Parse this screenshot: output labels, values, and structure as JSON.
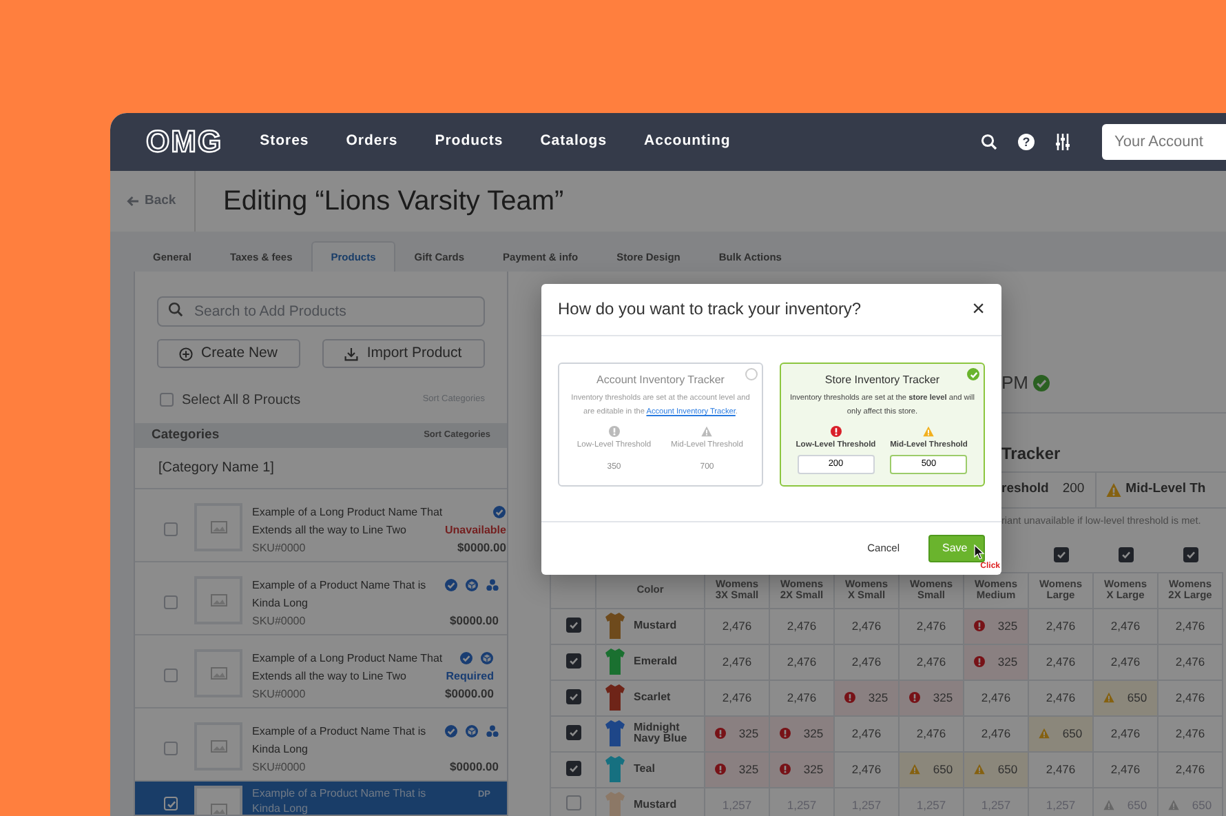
{
  "nav": {
    "logo": "OMG",
    "items": [
      "Stores",
      "Orders",
      "Products",
      "Catalogs",
      "Accounting"
    ],
    "help_glyph": "?",
    "account_placeholder": "Your Account"
  },
  "page": {
    "back": "Back",
    "title": "Editing “Lions Varsity Team”"
  },
  "tabs": [
    {
      "label": "General",
      "selected": false
    },
    {
      "label": "Taxes & fees",
      "selected": false
    },
    {
      "label": "Products",
      "selected": true
    },
    {
      "label": "Gift Cards",
      "selected": false
    },
    {
      "label": "Payment & info",
      "selected": false
    },
    {
      "label": "Store Design",
      "selected": false
    },
    {
      "label": "Bulk Actions",
      "selected": false
    }
  ],
  "products_panel": {
    "search_placeholder": "Search to Add Products",
    "create_button": "Create New",
    "import_button": "Import Product",
    "select_all": {
      "label": "Select All 8 Proucts",
      "checked": false
    },
    "sort_link": "Sort Categories",
    "categories_header": "Categories",
    "categories_sort": "Sort Categories",
    "category": "[Category Name 1]",
    "products": [
      {
        "name": "Example of a Long Product Name That Extends all the way to Line Two",
        "sku": "SKU#0000",
        "price": "$0000.00",
        "badges": [
          {
            "kind": "check"
          }
        ],
        "status": {
          "kind": "unavailable",
          "text": "Unavailable"
        },
        "checked": false,
        "selected": false
      },
      {
        "name": "Example of a Product Name That is Kinda Long",
        "sku": "SKU#0000",
        "price": "$0000.00",
        "badges": [
          {
            "kind": "check"
          },
          {
            "kind": "cube"
          },
          {
            "kind": "dots"
          }
        ],
        "checked": false,
        "selected": false
      },
      {
        "name": "Example of a Long Product Name That Extends all the way to Line Two",
        "sku": "SKU#0000",
        "price": "$0000.00",
        "badges": [
          {
            "kind": "check"
          },
          {
            "kind": "cube"
          }
        ],
        "status": {
          "kind": "required",
          "text": "Required"
        },
        "checked": false,
        "selected": false
      },
      {
        "name": "Example of a Product Name That is Kinda Long",
        "sku": "SKU#0000",
        "price": "$0000.00",
        "badges": [
          {
            "kind": "check"
          },
          {
            "kind": "cube"
          },
          {
            "kind": "dots"
          }
        ],
        "checked": false,
        "selected": false
      },
      {
        "name": "Example of a Product Name That is Kinda Long",
        "code": "DP",
        "checked": true,
        "selected": true
      }
    ]
  },
  "inventory": {
    "saved_time": "PM",
    "heading": "Tracker",
    "thresholds": [
      {
        "label": "reshold",
        "value": "200"
      },
      {
        "kind": "mid",
        "label": "Mid-Level Th"
      }
    ],
    "note": "riant unavailable if low-level threshold is met.",
    "table": {
      "color_header": "Color",
      "columns": [
        {
          "label": "Womens\n3X Small"
        },
        {
          "label": "Womens\n2X Small"
        },
        {
          "label": "Womens\nX Small"
        },
        {
          "label": "Womens\nSmall"
        },
        {
          "label": "Womens\nMedium"
        },
        {
          "label": "Womens\nLarge",
          "checked": true
        },
        {
          "label": "Womens\nX Large",
          "checked": true
        },
        {
          "label": "Womens\n2X Large",
          "checked": true
        }
      ],
      "rows": [
        {
          "name": "Mustard",
          "color": "#6e4a1c",
          "checked": true,
          "cells": [
            {
              "kind": "ok",
              "value": "2,476"
            },
            {
              "kind": "ok",
              "value": "2,476"
            },
            {
              "kind": "ok",
              "value": "2,476"
            },
            {
              "kind": "ok",
              "value": "2,476"
            },
            {
              "kind": "low",
              "value": "325"
            },
            {
              "kind": "ok",
              "value": "2,476"
            },
            {
              "kind": "ok",
              "value": "2,476"
            },
            {
              "kind": "ok",
              "value": "2,476"
            }
          ]
        },
        {
          "name": "Emerald",
          "color": "#1a7030",
          "checked": true,
          "cells": [
            {
              "kind": "ok",
              "value": "2,476"
            },
            {
              "kind": "ok",
              "value": "2,476"
            },
            {
              "kind": "ok",
              "value": "2,476"
            },
            {
              "kind": "ok",
              "value": "2,476"
            },
            {
              "kind": "low",
              "value": "325"
            },
            {
              "kind": "ok",
              "value": "2,476"
            },
            {
              "kind": "ok",
              "value": "2,476"
            },
            {
              "kind": "ok",
              "value": "2,476"
            }
          ]
        },
        {
          "name": "Scarlet",
          "color": "#6e2418",
          "checked": true,
          "cells": [
            {
              "kind": "ok",
              "value": "2,476"
            },
            {
              "kind": "ok",
              "value": "2,476"
            },
            {
              "kind": "low",
              "value": "325"
            },
            {
              "kind": "low",
              "value": "325"
            },
            {
              "kind": "ok",
              "value": "2,476"
            },
            {
              "kind": "ok",
              "value": "2,476"
            },
            {
              "kind": "mid",
              "value": "650"
            },
            {
              "kind": "ok",
              "value": "2,476"
            }
          ]
        },
        {
          "name": "Midnight\nNavy Blue",
          "color": "#1e4688",
          "checked": true,
          "cells": [
            {
              "kind": "low",
              "value": "325"
            },
            {
              "kind": "low",
              "value": "325"
            },
            {
              "kind": "ok",
              "value": "2,476"
            },
            {
              "kind": "ok",
              "value": "2,476"
            },
            {
              "kind": "ok",
              "value": "2,476"
            },
            {
              "kind": "mid",
              "value": "650"
            },
            {
              "kind": "ok",
              "value": "2,476"
            },
            {
              "kind": "ok",
              "value": "2,476"
            }
          ]
        },
        {
          "name": "Teal",
          "color": "#167080",
          "checked": true,
          "cells": [
            {
              "kind": "low",
              "value": "325"
            },
            {
              "kind": "low",
              "value": "325"
            },
            {
              "kind": "ok",
              "value": "2,476"
            },
            {
              "kind": "mid",
              "value": "650"
            },
            {
              "kind": "mid",
              "value": "650"
            },
            {
              "kind": "ok",
              "value": "2,476"
            },
            {
              "kind": "ok",
              "value": "2,476"
            },
            {
              "kind": "ok",
              "value": "2,476"
            }
          ]
        },
        {
          "name": "Mustard",
          "color": "#8c7866",
          "checked": false,
          "cells": [
            {
              "kind": "ok",
              "value": "1,257"
            },
            {
              "kind": "ok",
              "value": "1,257"
            },
            {
              "kind": "ok",
              "value": "1,257"
            },
            {
              "kind": "ok",
              "value": "1,257"
            },
            {
              "kind": "ok",
              "value": "1,257"
            },
            {
              "kind": "ok",
              "value": "1,257"
            },
            {
              "kind": "mid",
              "value": "650"
            },
            {
              "kind": "mid",
              "value": "650"
            }
          ]
        }
      ]
    }
  },
  "modal": {
    "title": "How do you want to track your inventory?",
    "close": "×",
    "options": [
      {
        "title": "Account Inventory Tracker",
        "selected": false,
        "description": "Inventory thresholds are set at the account level and are editable in the",
        "link": "Account Inventory Tracker",
        "description_end": ".",
        "thresholds": [
          {
            "kind": "low",
            "label": "Low-Level Threshold",
            "value": "350"
          },
          {
            "kind": "mid",
            "label": "Mid-Level Threshold",
            "value": "700"
          }
        ]
      },
      {
        "title": "Store Inventory Tracker",
        "selected": true,
        "description": "Inventory thresholds are set at the **store level** and will only affect this store.",
        "thresholds": [
          {
            "kind": "low",
            "label": "Low-Level Threshold",
            "value": "200"
          },
          {
            "kind": "mid",
            "label": "Mid-Level Threshold",
            "value": "500"
          }
        ]
      }
    ],
    "cancel": "Cancel",
    "save": "Save",
    "cursor_label": "Click"
  }
}
